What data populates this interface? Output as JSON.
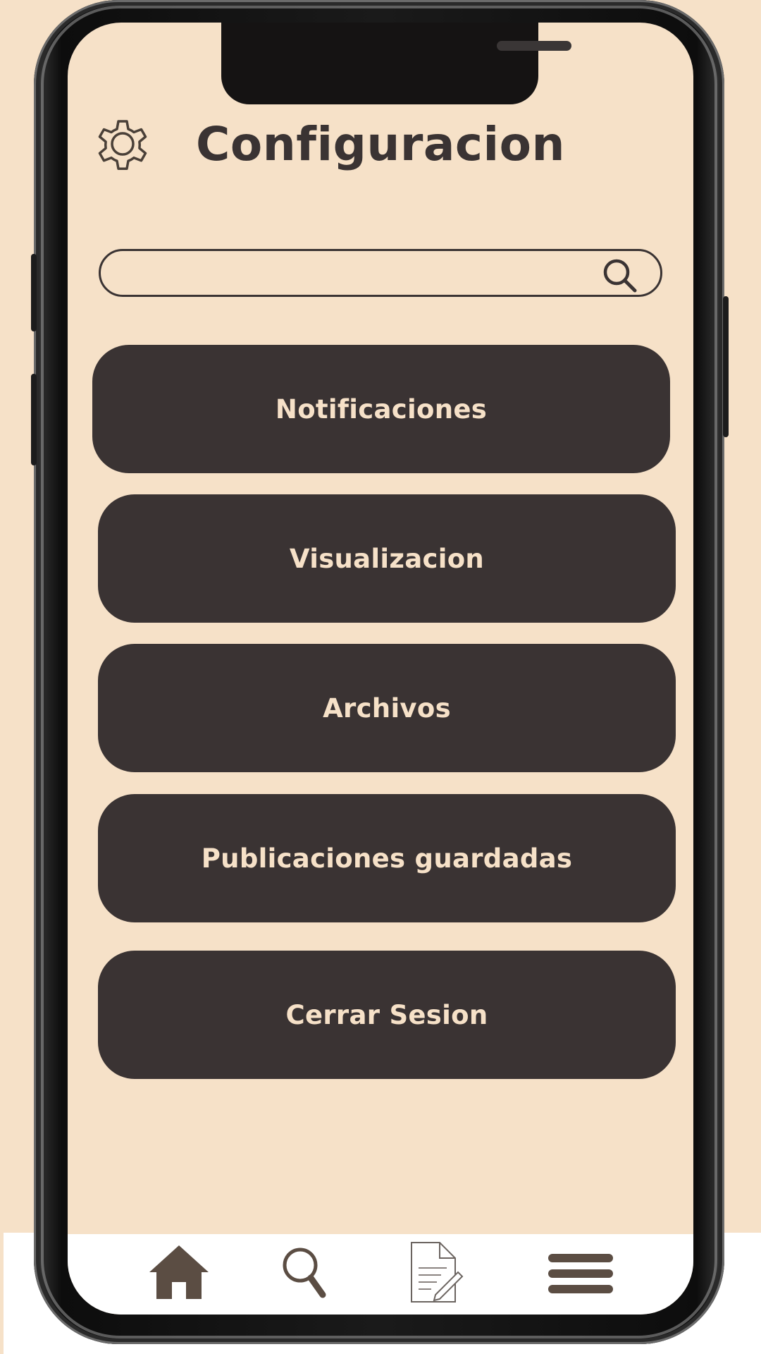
{
  "header": {
    "title": "Configuracion",
    "icon": "gear-icon"
  },
  "search": {
    "value": "",
    "placeholder": "",
    "icon": "search-icon"
  },
  "menu": {
    "items": [
      {
        "label": "Notificaciones"
      },
      {
        "label": "Visualizacion"
      },
      {
        "label": "Archivos"
      },
      {
        "label": "Publicaciones guardadas"
      },
      {
        "label": "Cerrar Sesion"
      }
    ]
  },
  "tabbar": {
    "items": [
      {
        "icon": "home-icon"
      },
      {
        "icon": "search-icon"
      },
      {
        "icon": "document-edit-icon"
      },
      {
        "icon": "hamburger-menu-icon"
      }
    ]
  },
  "colors": {
    "background": "#f6e1c8",
    "button": "#3a3333",
    "button_text": "#f6e1c8",
    "title": "#3a3333",
    "tab_icon": "#5b4d43"
  }
}
